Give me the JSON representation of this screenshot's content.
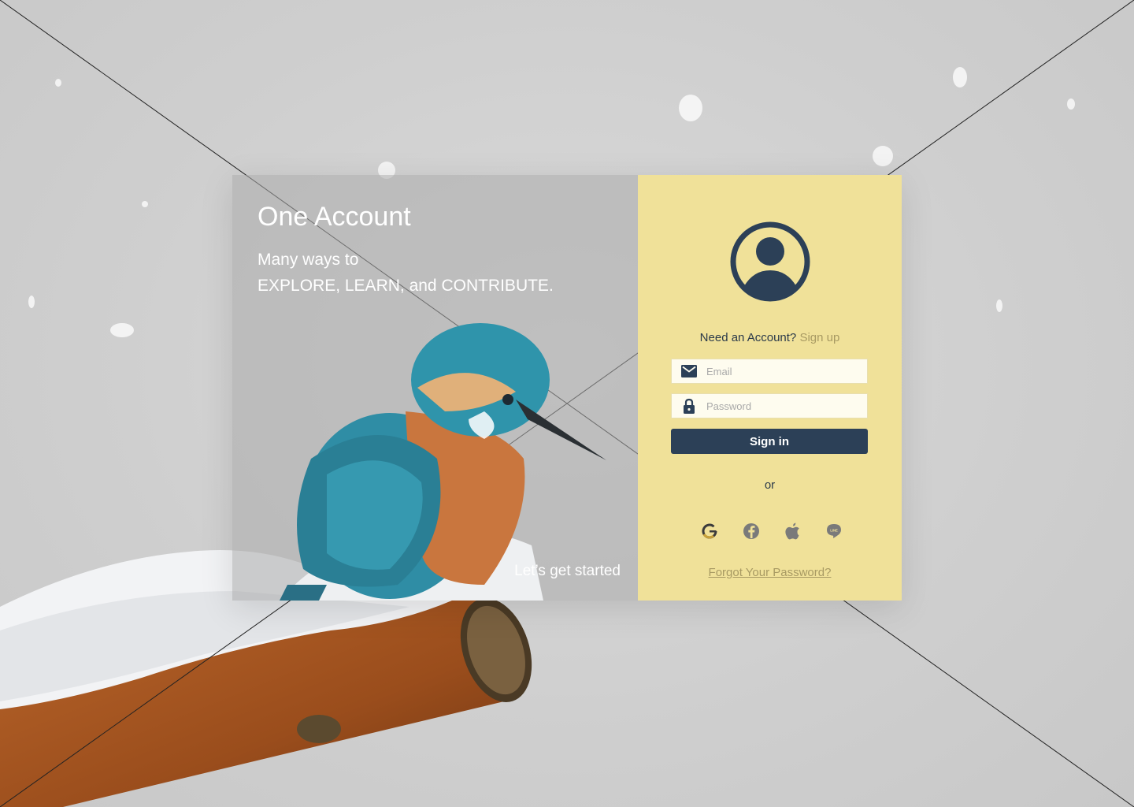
{
  "brand": {
    "title": "One Account",
    "subtitle_line1": "Many ways to",
    "subtitle_line2": "EXPLORE, LEARN, and CONTRIBUTE.",
    "cta": "Let’s get started"
  },
  "signin": {
    "need_account": "Need an Account?",
    "signup_link": "Sign up",
    "email_placeholder": "Email",
    "password_placeholder": "Password",
    "signin_button": "Sign in",
    "or": "or",
    "social": [
      "google-icon",
      "facebook-icon",
      "apple-icon",
      "line-icon"
    ],
    "forgot_password": "Forgot Your Password?"
  },
  "colors": {
    "panel": "#f0e199",
    "button": "#2c4057",
    "link": "#a89a63"
  }
}
